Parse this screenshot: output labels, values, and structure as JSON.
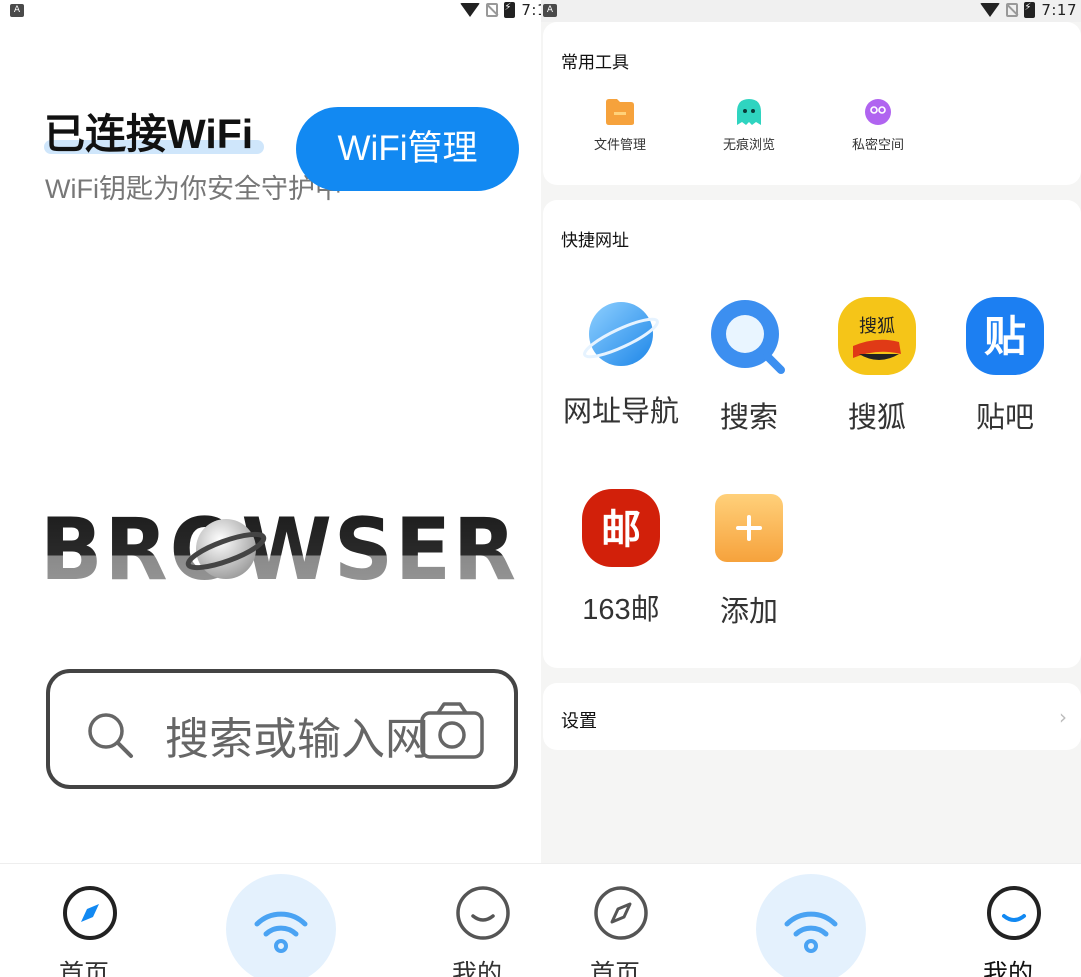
{
  "status_bar": {
    "time": "7:1",
    "time_right": "7:17",
    "notification_glyph": "A"
  },
  "home": {
    "wifi_title": "已连接WiFi",
    "wifi_subtitle": "WiFi钥匙为你安全守护中",
    "wifi_manage_label": "WiFi管理",
    "logo_text": "BROWSER",
    "search_placeholder": "搜索或输入网"
  },
  "profile": {
    "tools_title": "常用工具",
    "tools": [
      {
        "label": "文件管理",
        "icon": "folder-icon",
        "color": "#f6a23c"
      },
      {
        "label": "无痕浏览",
        "icon": "ghost-icon",
        "color": "#2fd4c0"
      },
      {
        "label": "私密空间",
        "icon": "private-space-icon",
        "color": "#b064f0"
      }
    ],
    "shortcuts_title": "快捷网址",
    "shortcuts": [
      {
        "label": "网址导航",
        "icon": "planet-icon"
      },
      {
        "label": "搜索",
        "icon": "search-icon"
      },
      {
        "label": "搜狐",
        "icon": "sohu-icon",
        "logo_text": "搜狐"
      },
      {
        "label": "贴吧",
        "icon": "tieba-icon",
        "logo_text": "贴"
      },
      {
        "label": "163邮",
        "icon": "mail163-icon",
        "logo_text": "邮"
      },
      {
        "label": "添加",
        "icon": "add-icon"
      }
    ],
    "settings_label": "设置"
  },
  "bottom_nav": {
    "home_label": "首页",
    "mine_label": "我的"
  },
  "colors": {
    "accent": "#1289f2",
    "nav_center_bg": "#e4f1fd"
  }
}
